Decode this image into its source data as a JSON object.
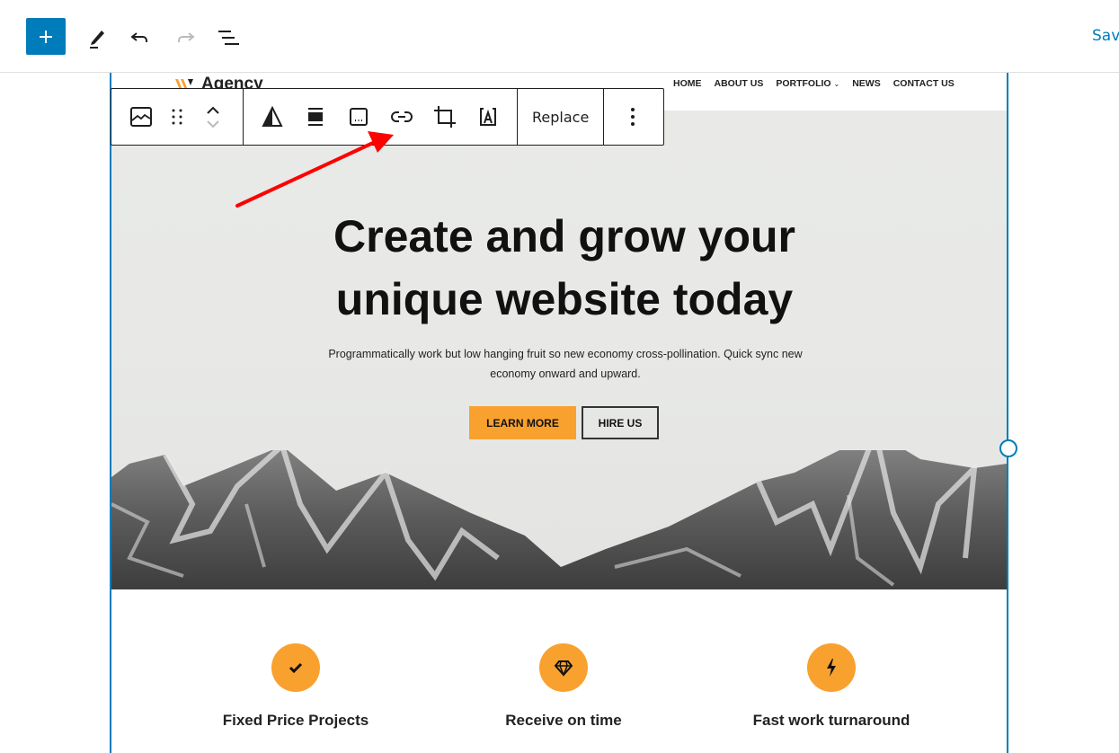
{
  "editor_toolbar": {
    "add_block_label": "Add block",
    "save_label": "Save"
  },
  "block_toolbar": {
    "replace_label": "Replace"
  },
  "site": {
    "logo_text": "Agency",
    "nav": [
      "HOME",
      "ABOUT US",
      "PORTFOLIO",
      "NEWS",
      "CONTACT US"
    ],
    "nav_dropdown_indicator": "⌄"
  },
  "hero": {
    "title_line1": "Create and grow your",
    "title_line2": "unique website today",
    "subtitle": "Programmatically work but low hanging fruit so new economy cross-pollination. Quick sync new economy onward and upward.",
    "primary_button": "LEARN MORE",
    "secondary_button": "HIRE US"
  },
  "features": [
    {
      "icon": "check-icon",
      "title": "Fixed Price Projects"
    },
    {
      "icon": "diamond-icon",
      "title": "Receive on time"
    },
    {
      "icon": "bolt-icon",
      "title": "Fast work turnaround"
    }
  ],
  "colors": {
    "accent": "#007cba",
    "brand_orange": "#f9a12f",
    "annotation_arrow": "#ff0000"
  }
}
